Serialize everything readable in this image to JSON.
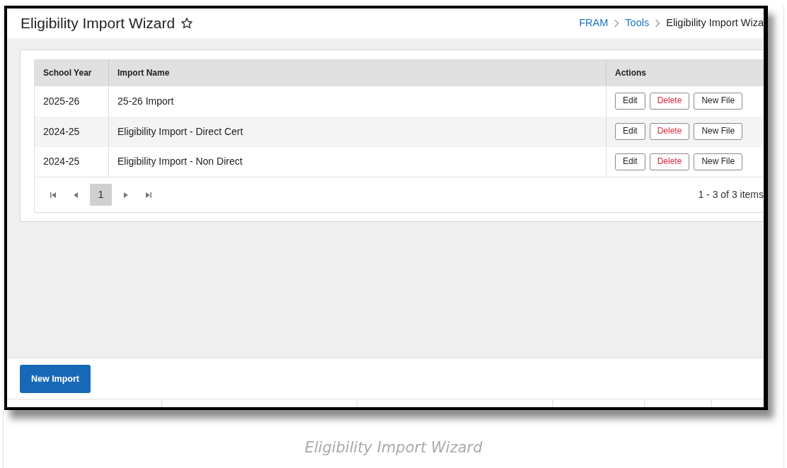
{
  "header": {
    "title": "Eligibility Import Wizard",
    "breadcrumbs": [
      {
        "label": "FRAM",
        "kind": "link"
      },
      {
        "label": "Tools",
        "kind": "link"
      },
      {
        "label": "Eligibility Import Wiza",
        "kind": "current"
      }
    ]
  },
  "table": {
    "columns": [
      "School Year",
      "Import Name",
      "Actions"
    ],
    "rows": [
      {
        "school_year": "2025-26",
        "import_name": "25-26 Import",
        "actions": [
          {
            "label": "Edit",
            "kind": "normal"
          },
          {
            "label": "Delete",
            "kind": "danger"
          },
          {
            "label": "New File",
            "kind": "normal"
          }
        ]
      },
      {
        "school_year": "2024-25",
        "import_name": "Eligibility Import - Direct Cert",
        "actions": [
          {
            "label": "Edit",
            "kind": "normal"
          },
          {
            "label": "Delete",
            "kind": "danger"
          },
          {
            "label": "New File",
            "kind": "normal"
          }
        ]
      },
      {
        "school_year": "2024-25",
        "import_name": "Eligibility Import - Non Direct",
        "actions": [
          {
            "label": "Edit",
            "kind": "normal"
          },
          {
            "label": "Delete",
            "kind": "danger"
          },
          {
            "label": "New File",
            "kind": "normal"
          }
        ]
      }
    ]
  },
  "pager": {
    "pages": [
      {
        "label": "1",
        "selected": true
      }
    ],
    "summary": "1 - 3 of 3 items"
  },
  "footer": {
    "button": "New Import"
  },
  "caption": "Eligibility Import Wizard"
}
